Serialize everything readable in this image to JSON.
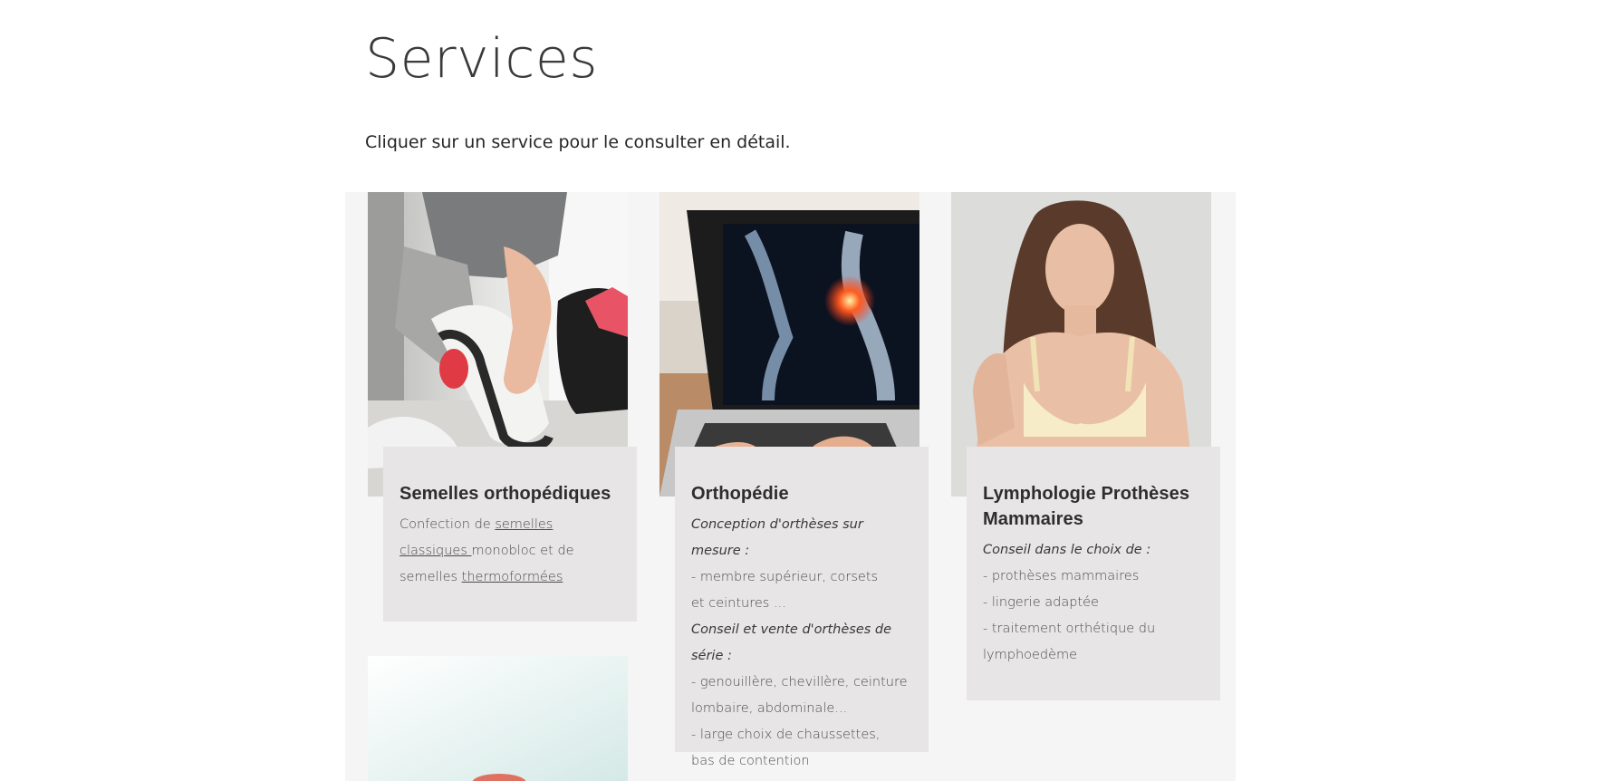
{
  "page": {
    "title": "Services",
    "subtitle": "Cliquer sur un service pour le consulter en détail."
  },
  "colors": {
    "gallery_background": "#f5f5f5",
    "panel_background": "#e7e5e5",
    "title_text": "#2e2e2e",
    "body_text": "#4d4b4b"
  },
  "services": [
    {
      "title": "Semelles orthopédiques",
      "image": "insole-foot-photo",
      "body": {
        "prefix": "Confection de ",
        "link1": "semelles",
        "link2": "classiques ",
        "middle": "monobloc  et de",
        "line3_prefix": "semelles ",
        "link3": "thermoformées"
      }
    },
    {
      "title": "Orthopédie",
      "image": "knee-xray-laptop-photo",
      "lines": [
        "Conception d'orthèses sur mesure :",
        "- membre supérieur, corsets",
        "et ceintures ...",
        "Conseil et vente d'orthèses de série :",
        "- genouillère, chevillère, ceinture",
        "lombaire, abdominale...",
        "- large choix de chaussettes,",
        "bas de contention"
      ]
    },
    {
      "title": "Lymphologie Prothèses Mammaires",
      "image": "woman-bra-photo",
      "lines": [
        "Conseil dans le choix de :",
        "- prothèses mammaires",
        "- lingerie adaptée",
        "- traitement orthétique du",
        "lymphoedème"
      ]
    }
  ]
}
